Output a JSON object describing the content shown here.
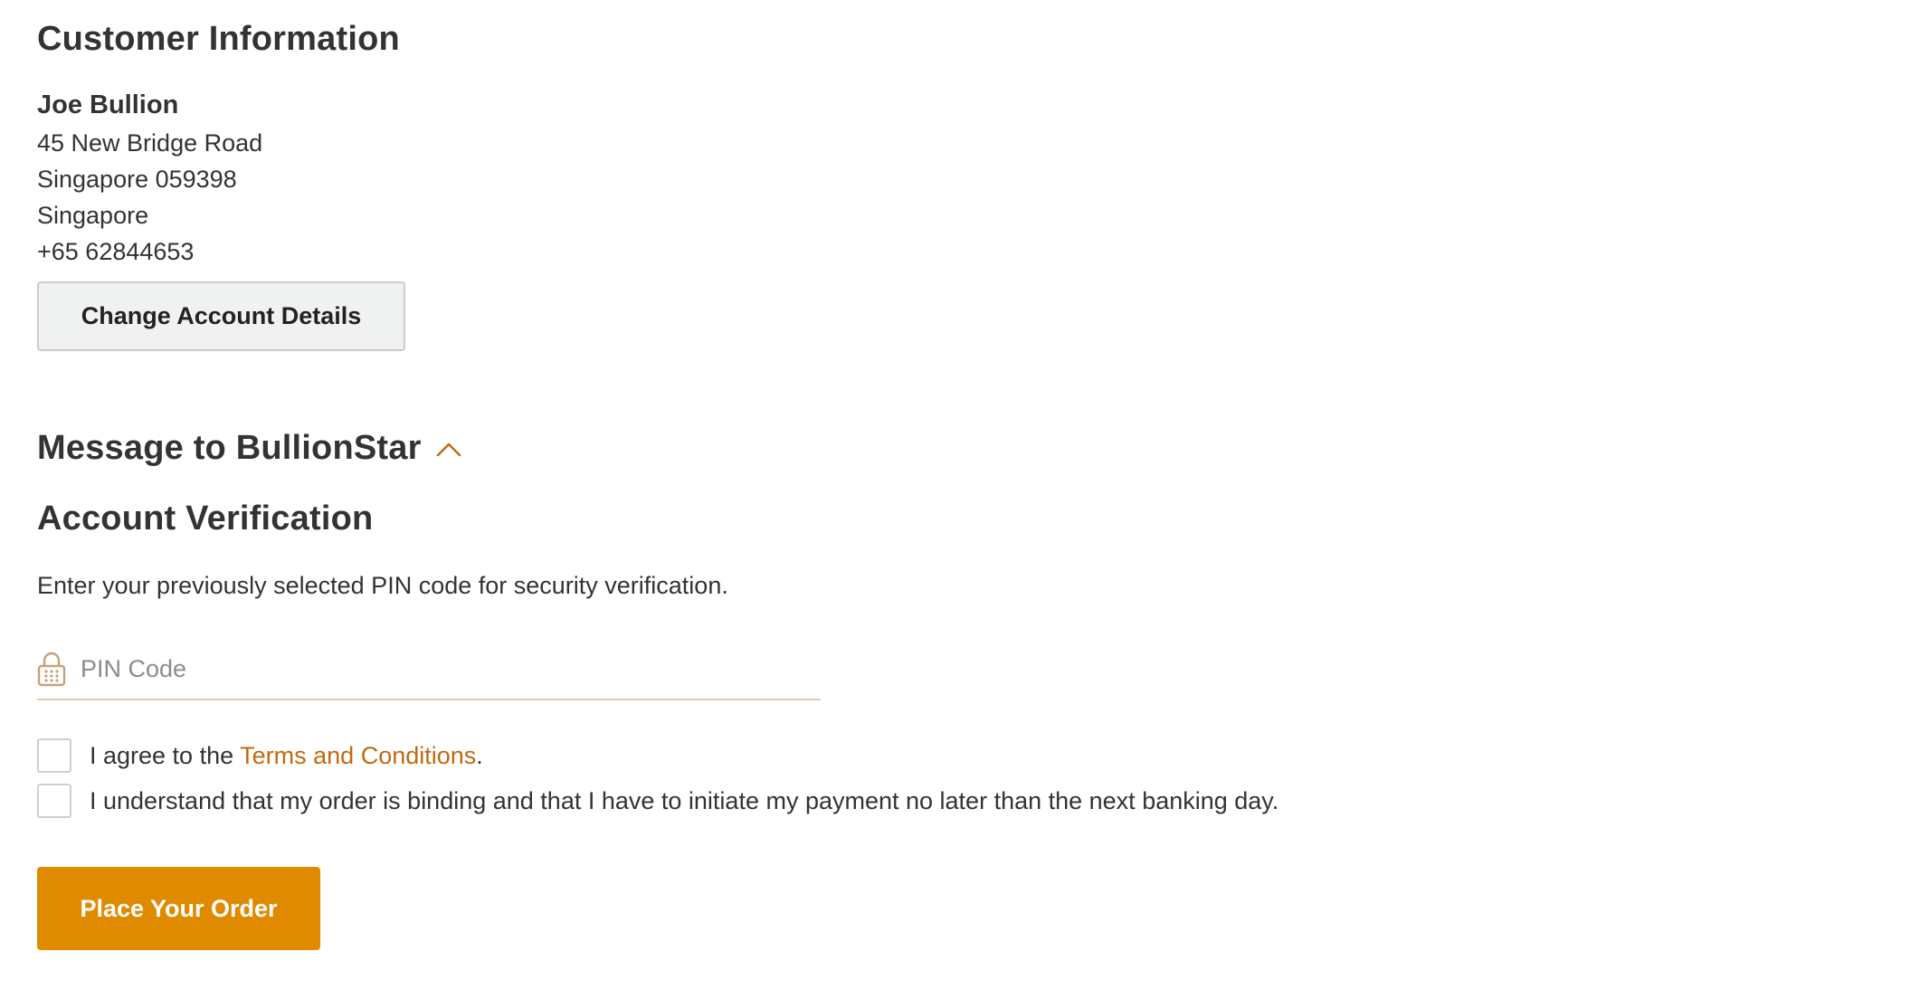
{
  "customer": {
    "heading": "Customer Information",
    "name": "Joe Bullion",
    "address_line1": "45 New Bridge Road",
    "address_line2": "Singapore 059398",
    "country": "Singapore",
    "phone": "+65 62844653",
    "change_button_label": "Change Account Details"
  },
  "message_section": {
    "heading": "Message to BullionStar",
    "toggle_icon": "chevron-up-icon",
    "accent_color": "#c06a0e"
  },
  "verification": {
    "heading": "Account Verification",
    "instruction": "Enter your previously selected PIN code for security verification.",
    "pin_icon": "lock-icon",
    "pin_placeholder": "PIN Code",
    "pin_value": ""
  },
  "agreements": {
    "terms_prefix": "I agree to the ",
    "terms_link_text": "Terms and Conditions",
    "terms_suffix": ".",
    "terms_checked": false,
    "binding_text": "I understand that my order is binding and that I have to initiate my payment no later than the next banking day.",
    "binding_checked": false
  },
  "order": {
    "place_order_label": "Place Your Order",
    "button_color": "#e08a00"
  }
}
